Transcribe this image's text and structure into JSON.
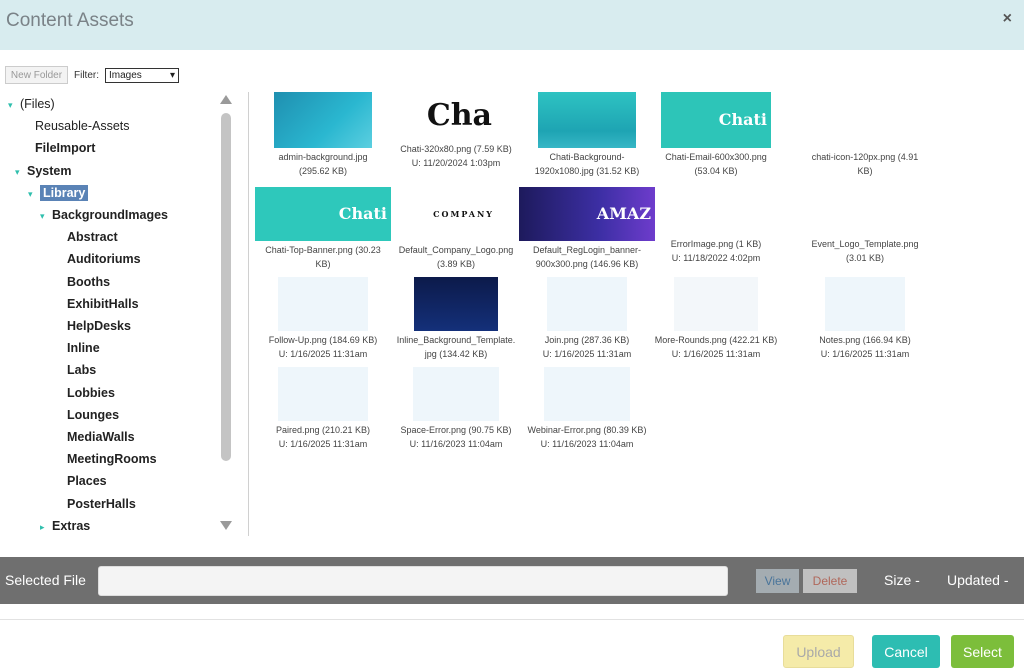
{
  "dialog": {
    "title": "Content Assets",
    "close_symbol": "×"
  },
  "toolbar": {
    "new_folder_label": "New Folder",
    "filter_label": "Filter:",
    "filter_value": "Images",
    "filter_chevron": "▾"
  },
  "tree": {
    "items": [
      {
        "label": "(Files)",
        "toggle": "▾",
        "bold": false,
        "selected": false
      },
      {
        "label": "Reusable-Assets",
        "toggle": "",
        "bold": false,
        "selected": false
      },
      {
        "label": "FileImport",
        "toggle": "",
        "bold": true,
        "selected": false
      },
      {
        "label": "System",
        "toggle": "▾",
        "bold": true,
        "selected": false
      },
      {
        "label": "Library",
        "toggle": "▾",
        "bold": true,
        "selected": true
      },
      {
        "label": "BackgroundImages",
        "toggle": "▾",
        "bold": true,
        "selected": false
      },
      {
        "label": "Abstract",
        "toggle": "",
        "bold": true,
        "selected": false
      },
      {
        "label": "Auditoriums",
        "toggle": "",
        "bold": true,
        "selected": false
      },
      {
        "label": "Booths",
        "toggle": "",
        "bold": true,
        "selected": false
      },
      {
        "label": "ExhibitHalls",
        "toggle": "",
        "bold": true,
        "selected": false
      },
      {
        "label": "HelpDesks",
        "toggle": "",
        "bold": true,
        "selected": false
      },
      {
        "label": "Inline",
        "toggle": "",
        "bold": true,
        "selected": false
      },
      {
        "label": "Labs",
        "toggle": "",
        "bold": true,
        "selected": false
      },
      {
        "label": "Lobbies",
        "toggle": "",
        "bold": true,
        "selected": false
      },
      {
        "label": "Lounges",
        "toggle": "",
        "bold": true,
        "selected": false
      },
      {
        "label": "MediaWalls",
        "toggle": "",
        "bold": true,
        "selected": false
      },
      {
        "label": "MeetingRooms",
        "toggle": "",
        "bold": true,
        "selected": false
      },
      {
        "label": "Places",
        "toggle": "",
        "bold": true,
        "selected": false
      },
      {
        "label": "PosterHalls",
        "toggle": "",
        "bold": true,
        "selected": false
      },
      {
        "label": "Extras",
        "toggle": "▸",
        "bold": true,
        "selected": false
      }
    ]
  },
  "files": [
    {
      "name": "admin-background.jpg",
      "meta": "(295.62 KB)",
      "thumb_text": ""
    },
    {
      "name": "Chati-320x80.png (7.59 KB)",
      "meta": "U: 11/20/2024 1:03pm",
      "thumb_text": "Cha"
    },
    {
      "name": "Chati-Background-",
      "meta": "1920x1080.jpg (31.52 KB)",
      "thumb_text": ""
    },
    {
      "name": "Chati-Email-600x300.png",
      "meta": "(53.04 KB)",
      "thumb_text": "Chati"
    },
    {
      "name": "chati-icon-120px.png (4.91",
      "meta": "KB)",
      "thumb_text": ""
    },
    {
      "name": "Chati-Top-Banner.png (30.23",
      "meta": "KB)",
      "thumb_text": "Chati"
    },
    {
      "name": "Default_Company_Logo.png",
      "meta": "(3.89 KB)",
      "thumb_text": "COMPANY"
    },
    {
      "name": "Default_RegLogin_banner-",
      "meta": "900x300.png (146.96 KB)",
      "thumb_text": "AMAZ"
    },
    {
      "name": "ErrorImage.png (1 KB)",
      "meta": "U: 11/18/2022 4:02pm",
      "thumb_text": ""
    },
    {
      "name": "Event_Logo_Template.png",
      "meta": "(3.01 KB)",
      "thumb_text": ""
    },
    {
      "name": "Follow-Up.png (184.69 KB)",
      "meta": "U: 1/16/2025 11:31am",
      "thumb_text": ""
    },
    {
      "name": "Inline_Background_Template.",
      "meta": "jpg (134.42 KB)",
      "thumb_text": ""
    },
    {
      "name": "Join.png (287.36 KB)",
      "meta": "U: 1/16/2025 11:31am",
      "thumb_text": ""
    },
    {
      "name": "More-Rounds.png (422.21 KB)",
      "meta": "U: 1/16/2025 11:31am",
      "thumb_text": ""
    },
    {
      "name": "Notes.png (166.94 KB)",
      "meta": "U: 1/16/2025 11:31am",
      "thumb_text": ""
    },
    {
      "name": "Paired.png (210.21 KB)",
      "meta": "U: 1/16/2025 11:31am",
      "thumb_text": ""
    },
    {
      "name": "Space-Error.png (90.75 KB)",
      "meta": "U: 11/16/2023 11:04am",
      "thumb_text": ""
    },
    {
      "name": "Webinar-Error.png (80.39 KB)",
      "meta": "U: 11/16/2023 11:04am",
      "thumb_text": ""
    }
  ],
  "selected_file": {
    "label": "Selected File",
    "value": "",
    "view_label": "View",
    "delete_label": "Delete",
    "size_label": "Size -",
    "updated_label": "Updated -"
  },
  "footer": {
    "upload_label": "Upload",
    "cancel_label": "Cancel",
    "select_label": "Select"
  },
  "colors": {
    "title_bg": "#d8ecef",
    "teal": "#2dbdb2",
    "green": "#7cbe3b",
    "selected_tree": "#5a83b6"
  }
}
